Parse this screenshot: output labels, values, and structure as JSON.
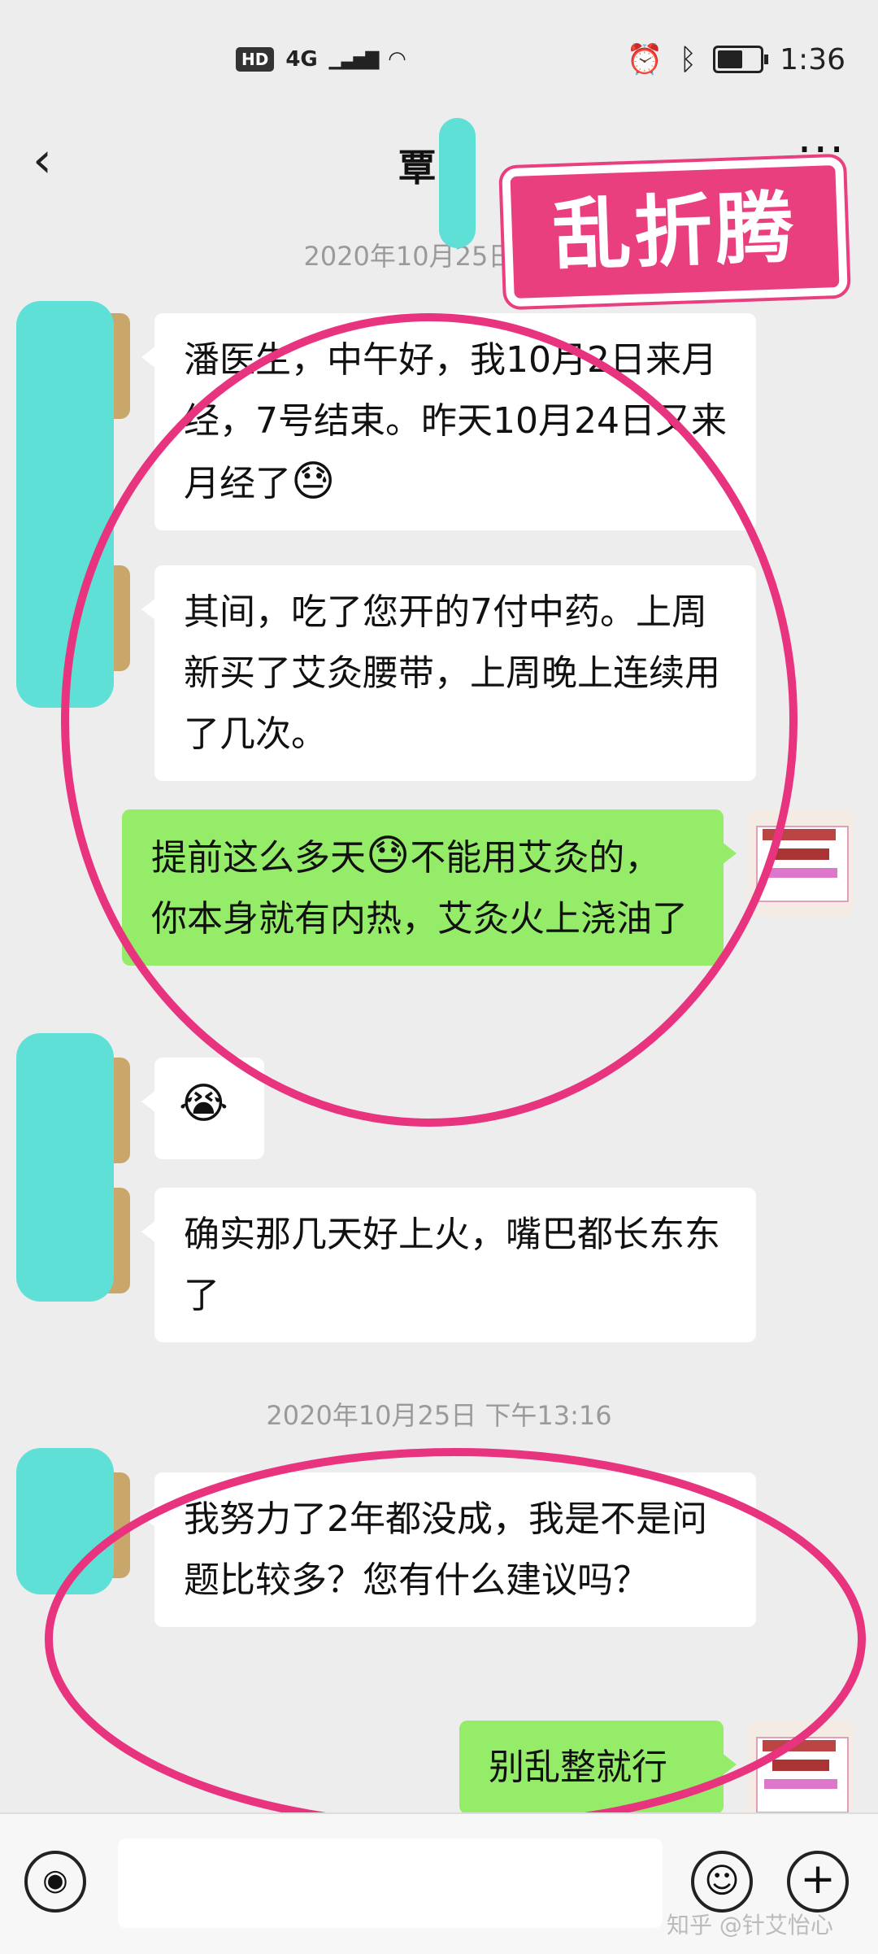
{
  "status_bar": {
    "hd": "HD",
    "network": "4G",
    "signal_icon": "signal-bars-icon",
    "wifi_icon": "wifi-icon",
    "alarm_icon": "alarm-icon",
    "bluetooth_icon": "bluetooth-icon",
    "battery_icon": "battery-icon",
    "time": "1:36"
  },
  "header": {
    "back_icon": "chevron-left-icon",
    "title": "覃",
    "more_icon": "more-dots-icon"
  },
  "annotation": {
    "sticker_text": "乱折腾",
    "circle_color": "#e8347f",
    "redaction_color": "#5fe0d7"
  },
  "timestamps": [
    "2020年10月25日 下午",
    "2020年10月25日 下午13:16"
  ],
  "messages": [
    {
      "side": "left",
      "text": "潘医生，中午好，我10月2日来月经，7号结束。昨天10月24日又来月经了",
      "emoji": "😓"
    },
    {
      "side": "left",
      "text": "其间，吃了您开的7付中药。上周新买了艾灸腰带，上周晚上连续用了几次。",
      "emoji": ""
    },
    {
      "side": "right",
      "text_a": "提前这么多天",
      "emoji": "😓",
      "text_b": "不能用艾灸的，你本身就有内热，艾灸火上浇油了"
    },
    {
      "side": "left",
      "text": "",
      "emoji": "😭"
    },
    {
      "side": "left",
      "text": "确实那几天好上火，嘴巴都长东东了",
      "emoji": ""
    },
    {
      "side": "left",
      "text": "我努力了2年都没成，我是不是问题比较多？您有什么建议吗？",
      "emoji": ""
    },
    {
      "side": "right",
      "text": "别乱整就行",
      "emoji": ""
    }
  ],
  "input_bar": {
    "voice_icon": "voice-icon",
    "emoji_icon": "smiley-icon",
    "plus_icon": "plus-icon"
  },
  "watermark": "知乎 @针艾怡心",
  "colors": {
    "background": "#ededed",
    "bubble_left": "#ffffff",
    "bubble_right": "#95ec69"
  }
}
